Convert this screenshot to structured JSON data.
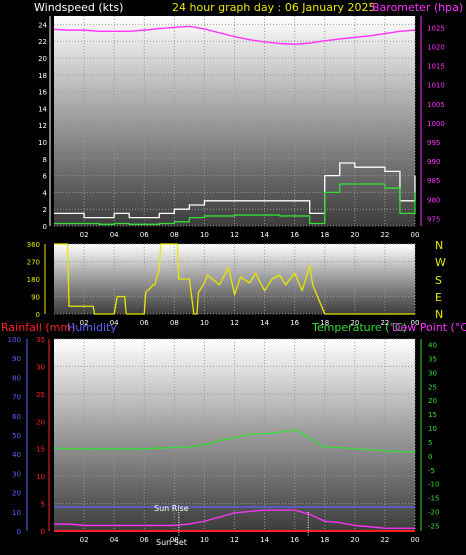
{
  "header": {
    "windspeed_label": "Windspeed (kts)",
    "title": "24 hour graph day : 06 January 2025",
    "barometer_label": "Barometer (hpa)"
  },
  "lower_header": {
    "rainfall_label": "Rainfall (mm)",
    "humidity_label": "Humidity",
    "temperature_label": "Temperature (°C)",
    "dewpoint_label": "Dew Point (°C)"
  },
  "compass": [
    "N",
    "W",
    "S",
    "E",
    "N"
  ],
  "markers": {
    "sunrise_label": "Sun Rise",
    "sunset_label": "Sun Set",
    "sunrise_hour": 8.3,
    "sunset_hour": 16.9
  },
  "colors": {
    "windspeed": "#ffffff",
    "windavg": "#33dd33",
    "barometer": "#ff33ff",
    "direction": "#e8e800",
    "rainfall": "#ff2020",
    "humidity": "#6060ff",
    "temperature": "#33dd33",
    "dewpoint": "#ff33ff",
    "title": "#e8e800"
  },
  "chart_data": [
    {
      "id": "wind",
      "type": "line",
      "x_ticks": [
        "02",
        "04",
        "06",
        "08",
        "10",
        "12",
        "14",
        "16",
        "18",
        "20",
        "22",
        "00"
      ],
      "y_left_ticks": [
        "0",
        "2",
        "4",
        "6",
        "8",
        "10",
        "12",
        "14",
        "16",
        "18",
        "20",
        "22",
        "24"
      ],
      "y_left_lim": [
        0,
        25
      ],
      "y_right_ticks": [
        "975",
        "980",
        "985",
        "990",
        "995",
        "1000",
        "1005",
        "1010",
        "1015",
        "1020",
        "1025"
      ],
      "y_right_lim": [
        973,
        1028
      ],
      "series": [
        {
          "name": "Windspeed (kts)",
          "axis": "left",
          "x": [
            0,
            1,
            2,
            3,
            4,
            5,
            6,
            7,
            8,
            9,
            10,
            11,
            12,
            13,
            14,
            15,
            16,
            17,
            18,
            19,
            20,
            21,
            22,
            23,
            24
          ],
          "values": [
            1.5,
            1.5,
            1,
            1,
            1.5,
            1,
            1,
            1.5,
            2,
            2.5,
            3,
            3,
            3,
            3,
            3,
            3,
            3,
            1.5,
            6,
            7.5,
            7,
            7,
            6.5,
            3,
            6
          ]
        },
        {
          "name": "Windspeed average",
          "axis": "left",
          "x": [
            0,
            1,
            2,
            3,
            4,
            5,
            6,
            7,
            8,
            9,
            10,
            11,
            12,
            13,
            14,
            15,
            16,
            17,
            18,
            19,
            20,
            21,
            22,
            23,
            24
          ],
          "values": [
            0.3,
            0.3,
            0.3,
            0.2,
            0.3,
            0.2,
            0.2,
            0.3,
            0.5,
            1,
            1.2,
            1.2,
            1.3,
            1.3,
            1.3,
            1.2,
            1.2,
            0.3,
            4,
            5,
            5,
            5,
            4.5,
            1.5,
            4
          ]
        },
        {
          "name": "Barometer (hpa)",
          "axis": "right",
          "x": [
            0,
            1,
            2,
            3,
            4,
            5,
            6,
            7,
            8,
            9,
            10,
            11,
            12,
            13,
            14,
            15,
            16,
            17,
            18,
            19,
            20,
            21,
            22,
            23,
            24
          ],
          "values": [
            1024.5,
            1024.3,
            1024.3,
            1024.0,
            1024.0,
            1024.0,
            1024.3,
            1024.7,
            1025.0,
            1025.3,
            1024.6,
            1023.6,
            1022.6,
            1021.8,
            1021.2,
            1020.8,
            1020.6,
            1020.9,
            1021.5,
            1022.0,
            1022.4,
            1022.8,
            1023.4,
            1024.0,
            1024.3
          ]
        }
      ]
    },
    {
      "id": "direction",
      "type": "line",
      "x_ticks": [
        "02",
        "04",
        "06",
        "08",
        "10",
        "12",
        "14",
        "16",
        "18",
        "20",
        "22",
        "00"
      ],
      "y_ticks": [
        "0",
        "90",
        "180",
        "270",
        "360"
      ],
      "y_lim": [
        0,
        360
      ],
      "series": [
        {
          "name": "Wind direction",
          "x": [
            0,
            0.9,
            1,
            1.5,
            2,
            2.6,
            2.7,
            4,
            4.2,
            4.7,
            4.8,
            6,
            6.1,
            6.6,
            6.7,
            7,
            7.1,
            8.2,
            8.3,
            9,
            9.3,
            9.5,
            9.6,
            10,
            10.2,
            11,
            11.6,
            12,
            12.4,
            13,
            13.4,
            14,
            14.5,
            15,
            15.4,
            16,
            16.5,
            17,
            17.2,
            18,
            18.1,
            19,
            19.1,
            24
          ],
          "values": [
            360,
            360,
            40,
            40,
            40,
            40,
            0,
            0,
            90,
            90,
            0,
            0,
            110,
            150,
            150,
            230,
            360,
            360,
            180,
            180,
            0,
            0,
            110,
            160,
            200,
            150,
            240,
            100,
            190,
            160,
            210,
            120,
            180,
            200,
            150,
            210,
            120,
            250,
            150,
            0,
            0,
            0,
            0,
            0
          ]
        }
      ]
    },
    {
      "id": "temperature",
      "type": "line",
      "x_ticks": [
        "02",
        "04",
        "06",
        "08",
        "10",
        "12",
        "14",
        "16",
        "18",
        "20",
        "22",
        "00"
      ],
      "y_left_ticks": [
        "0",
        "5",
        "10",
        "15",
        "20",
        "25",
        "30",
        "35"
      ],
      "y_left_lim": [
        0,
        35
      ],
      "y_outer_ticks": [
        "0",
        "10",
        "20",
        "30",
        "40",
        "50",
        "60",
        "70",
        "80",
        "90",
        "100"
      ],
      "y_outer_lim": [
        0,
        100
      ],
      "y_right_ticks": [
        "40",
        "35",
        "30",
        "25",
        "20",
        "15",
        "10",
        "5",
        "0",
        "-5",
        "-10",
        "-15",
        "-20",
        "-25"
      ],
      "y_right_lim": [
        -27,
        42
      ],
      "series": [
        {
          "name": "Temperature (°C)",
          "axis": "right",
          "x": [
            0,
            1,
            2,
            3,
            4,
            5,
            6,
            7,
            8,
            9,
            10,
            11,
            12,
            13,
            14,
            15,
            16,
            17,
            18,
            19,
            20,
            21,
            22,
            23,
            24
          ],
          "values": [
            2.8,
            2.5,
            2.5,
            2.5,
            2.5,
            2.5,
            2.5,
            2.8,
            3,
            3.2,
            4,
            5.5,
            6.5,
            7.8,
            8,
            8.5,
            9.5,
            6.5,
            3,
            3,
            2.5,
            2.2,
            1.8,
            1.5,
            1.5
          ]
        },
        {
          "name": "Dew Point (°C)",
          "axis": "right",
          "x": [
            0,
            1,
            2,
            3,
            4,
            5,
            6,
            7,
            8,
            9,
            10,
            11,
            12,
            13,
            14,
            15,
            16,
            17,
            18,
            19,
            20,
            21,
            22,
            23,
            24
          ],
          "values": [
            -24.5,
            -24.5,
            -25,
            -25,
            -25,
            -25,
            -25,
            -25,
            -25,
            -24.5,
            -23.5,
            -22,
            -20.5,
            -20,
            -19.5,
            -19.5,
            -19.5,
            -21,
            -23.5,
            -24,
            -25,
            -25.5,
            -26,
            -26,
            -26
          ]
        },
        {
          "name": "Rainfall (mm)",
          "axis": "left",
          "x": [
            0,
            24
          ],
          "values": [
            0,
            0
          ]
        },
        {
          "name": "Humidity",
          "axis": "outer",
          "x": [
            0,
            24
          ],
          "values": [
            12.5,
            12.5
          ]
        }
      ]
    }
  ]
}
